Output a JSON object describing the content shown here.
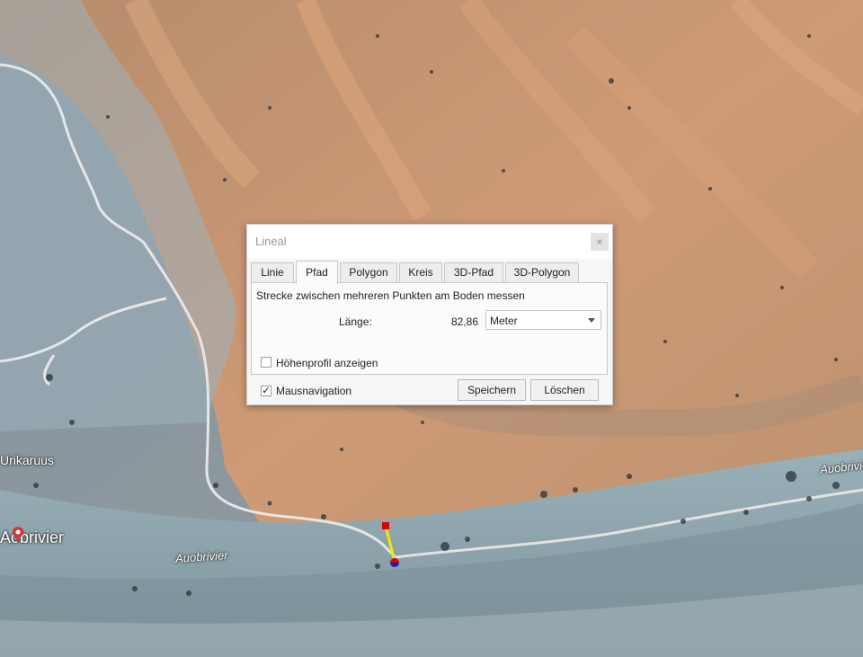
{
  "map": {
    "labels": {
      "road_left": "Auobrivier",
      "road_right": "Auobrivier",
      "place_small": "Urikaruus",
      "place_large": "Aobrivier"
    },
    "colors": {
      "dunes": "#c99a78",
      "valley": "#8aa0a8",
      "road": "#e8e8e8",
      "ruler_line": "#f5e600",
      "ruler_start": "#e00000",
      "ruler_end": "#1020c0"
    }
  },
  "dialog": {
    "title": "Lineal",
    "close_symbol": "×",
    "tabs": [
      {
        "label": "Linie",
        "active": false
      },
      {
        "label": "Pfad",
        "active": true
      },
      {
        "label": "Polygon",
        "active": false
      },
      {
        "label": "Kreis",
        "active": false
      },
      {
        "label": "3D-Pfad",
        "active": false
      },
      {
        "label": "3D-Polygon",
        "active": false
      }
    ],
    "description": "Strecke zwischen mehreren Punkten am Boden messen",
    "length_label": "Länge:",
    "length_value": "82,86",
    "unit": "Meter",
    "elevation_profile_label": "Höhenprofil anzeigen",
    "elevation_profile_checked": false,
    "mouse_navigation_label": "Mausnavigation",
    "mouse_navigation_checked": true,
    "check_mark": "✓",
    "save_label": "Speichern",
    "delete_label": "Löschen"
  }
}
